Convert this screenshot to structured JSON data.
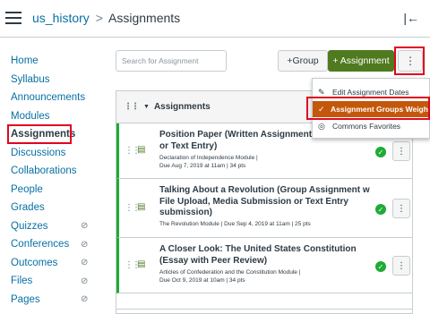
{
  "breadcrumb": {
    "course": "us_history",
    "separator": ">",
    "current": "Assignments"
  },
  "nav": [
    {
      "label": "Home",
      "hidden": false
    },
    {
      "label": "Syllabus",
      "hidden": false
    },
    {
      "label": "Announcements",
      "hidden": false
    },
    {
      "label": "Modules",
      "hidden": false
    },
    {
      "label": "Assignments",
      "hidden": false,
      "active": true
    },
    {
      "label": "Discussions",
      "hidden": false
    },
    {
      "label": "Collaborations",
      "hidden": false
    },
    {
      "label": "People",
      "hidden": false
    },
    {
      "label": "Grades",
      "hidden": false
    },
    {
      "label": "Quizzes",
      "hidden": true
    },
    {
      "label": "Conferences",
      "hidden": true
    },
    {
      "label": "Outcomes",
      "hidden": true
    },
    {
      "label": "Files",
      "hidden": true
    },
    {
      "label": "Pages",
      "hidden": true
    }
  ],
  "toolbar": {
    "search_placeholder": "Search for Assignment",
    "group_label": "+Group",
    "assignment_label": "+ Assignment",
    "kebab": "⋮"
  },
  "menu": {
    "items": [
      "Edit Assignment Dates",
      "Assignment Groups Weight",
      "Commons Favorites"
    ]
  },
  "group": {
    "title": "Assignments"
  },
  "assignments": [
    {
      "title": "Position Paper (Written Assignment w File Upload or Text Entry)",
      "module": "Declaration of Independence Module  |",
      "due": "Due Aug 7, 2019 at 11am  |  34 pts"
    },
    {
      "title": "Talking About a Revolution (Group Assignment w File Upload, Media Submission or Text Entry submission)",
      "module": "The Revolution Module  |  Due Sep 4, 2019 at 11am  |  25 pts",
      "due": ""
    },
    {
      "title": "A Closer Look: The United States Constitution (Essay with Peer Review)",
      "module": "Articles of Confederation and the Constitution Module  |",
      "due": "Due Oct 9, 2019 at 10am  |  34 pts"
    }
  ],
  "colors": {
    "accent_link": "#0770a3",
    "primary_button": "#4f7a1f",
    "published": "#1eab36",
    "menu_highlight": "#c4570a",
    "annotation_box": "#e0061f"
  }
}
